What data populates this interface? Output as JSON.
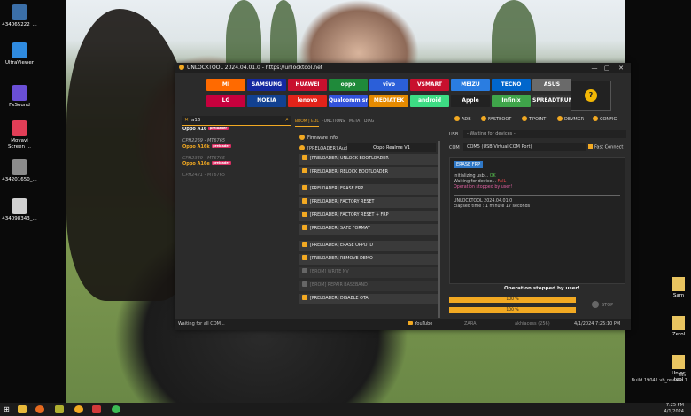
{
  "desktop": {
    "icons": [
      {
        "label": "434065222_...",
        "color": "#3b6fa8"
      },
      {
        "label": "UltraViewer",
        "color": "#2f8be0"
      },
      {
        "label": "FxSound",
        "color": "#6a4fd6"
      },
      {
        "label": "Movavi Screen ...",
        "color": "#e23e57"
      },
      {
        "label": "434201650_...",
        "color": "#8c8c8c"
      },
      {
        "label": "434098343_...",
        "color": "#d0d0d0"
      }
    ],
    "right_icons": [
      {
        "label": "Sam"
      },
      {
        "label": "Zerol"
      },
      {
        "label": "Unloc tool"
      }
    ],
    "watermark": [
      "Win",
      "Build 19041.vb_release.1"
    ]
  },
  "app": {
    "title": "UNLOCKTOOL 2024.04.01.0 - https://unlocktool.net",
    "window_buttons": [
      "—",
      "▢",
      "✕"
    ],
    "brands": [
      {
        "label": "MI",
        "color": "#ff6a00"
      },
      {
        "label": "SAMSUNG",
        "color": "#1428a0"
      },
      {
        "label": "HUAWEI",
        "color": "#c8102e"
      },
      {
        "label": "oppo",
        "color": "#1f8a3a"
      },
      {
        "label": "vivo",
        "color": "#2b5fd9"
      },
      {
        "label": "VSMART",
        "color": "#c8102e"
      },
      {
        "label": "MEIZU",
        "color": "#2a7de1"
      },
      {
        "label": "TECNO",
        "color": "#0066cc"
      },
      {
        "label": "ASUS",
        "color": "#6a6a6a"
      },
      {
        "label": "LG",
        "color": "#c6003d"
      },
      {
        "label": "NOKIA",
        "color": "#124191"
      },
      {
        "label": "lenovo",
        "color": "#e2231a"
      },
      {
        "label": "Qualcomm snapdragon",
        "color": "#3253dc"
      },
      {
        "label": "MEDIATEK",
        "color": "#e58a00"
      },
      {
        "label": "android",
        "color": "#3ddc84"
      },
      {
        "label": "Apple",
        "color": "#222222"
      },
      {
        "label": "Infinix",
        "color": "#3fa54a"
      },
      {
        "label": "SPREADTRUM",
        "color": "#333333"
      }
    ],
    "search_value": "a16",
    "models": [
      {
        "text": "Oppo A16",
        "badge": "preloader",
        "style": "name"
      },
      {
        "text": "",
        "style": "code"
      },
      {
        "text": "CPH2269 - MT6765",
        "style": "code"
      },
      {
        "text": "Oppo A16k",
        "badge": "preloader",
        "style": "name orange"
      },
      {
        "text": "",
        "style": "code"
      },
      {
        "text": "CPH2349 - MT6765",
        "style": "dim"
      },
      {
        "text": "Oppo A16e",
        "badge": "preloader",
        "style": "name orange"
      },
      {
        "text": "",
        "style": "code"
      },
      {
        "text": "CPH2421 - MT6765",
        "style": "dim"
      }
    ],
    "tabs": [
      "BROM | EDL",
      "FUNCTIONS",
      "META",
      "DIAG"
    ],
    "firmware_info": "Firmware Info",
    "preloader_auth": "[PRELOADER] Auth",
    "device_select": "Oppo Realme V1",
    "ops": [
      {
        "label": "[PRELOADER] UNLOCK BOOTLOADER",
        "disabled": false
      },
      {
        "label": "[PRELOADER] RELOCK BOOTLOADER",
        "disabled": false
      },
      {
        "gap": true
      },
      {
        "label": "[PRELOADER] ERASE FRP",
        "disabled": false
      },
      {
        "label": "[PRELOADER] FACTORY RESET",
        "disabled": false
      },
      {
        "label": "[PRELOADER] FACTORY RESET + FRP",
        "disabled": false
      },
      {
        "label": "[PRELOADER] SAFE FORMAT",
        "disabled": false
      },
      {
        "gap": true
      },
      {
        "label": "[PRELOADER] ERASE OPPO ID",
        "disabled": false
      },
      {
        "label": "[PRELOADER] REMOVE DEMO",
        "disabled": false
      },
      {
        "label": "[BROM] WRITE NV",
        "disabled": true
      },
      {
        "label": "[BROM] REPAIR BASEBAND",
        "disabled": true
      },
      {
        "label": "[PRELOADER] DISABLE OTA",
        "disabled": false
      }
    ],
    "toolbar": [
      "ADB",
      "FASTBOOT",
      "T.POINT",
      "DEVMGR",
      "CONFIG"
    ],
    "usb_label": "USB",
    "usb_value": "- Waiting for devices -",
    "com_label": "COM",
    "com_value": "COM5 (USB Virtual COM Port)",
    "fast_connect": "Fast Connect",
    "log": {
      "tag": "ERASE FRP",
      "line1_prefix": "Initializing usb... ",
      "line1_status": "OK",
      "line2_prefix": "Waiting for device... ",
      "line2_status": "FAIL",
      "line3": "Operation stopped by user!",
      "line4": "UNLOCKTOOL 2024.04.01.0",
      "line5": "Elapsed time : 1 minute 17 seconds"
    },
    "operation_status": "Operation stopped by user!",
    "progress1": "100 %",
    "progress2": "100 %",
    "progress_values": [
      100,
      100
    ],
    "stop_label": "STOP",
    "status": {
      "left": "Waiting for all COM...",
      "youtube": "YouTube",
      "user1": "ZARA",
      "user2": "akhiacess (256)",
      "datetime": "4/1/2024 7:25:10 PM"
    }
  },
  "tray": {
    "time": "7:25 PM",
    "date": "4/1/2024"
  }
}
